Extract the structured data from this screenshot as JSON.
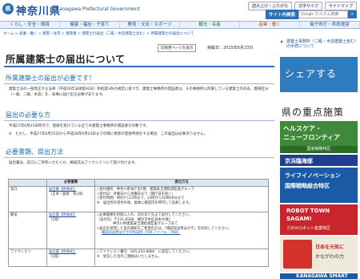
{
  "header": {
    "logo_mark": "県",
    "logo_text": "神奈川県",
    "logo_en": "Kanagawa Prefectural Government",
    "util_links": [
      "読み上げ・ふりがな",
      "文字サイズ",
      "サイトマップ"
    ],
    "search_label": "サイト内検索",
    "search_placeholder": "Google カスタム検索",
    "search_icon": "search-icon"
  },
  "gnav": [
    "くらし・安全・環境",
    "健康・福祉・子育て",
    "教育・文化・スポーツ",
    "観光・名産",
    "産業・働く",
    "電子県庁・県政運営"
  ],
  "breadcrumb": "ホーム > 産業・働く > 建築・住宅 > 建築業 > 建築士の届出（二級・木造建築士含む）> 所属建築士の届出について",
  "main": {
    "print_label": "印刷用ページを表示",
    "date_text": "掲載日：2015年6月23日",
    "title": "所属建築士の届出について",
    "sections": [
      {
        "heading": "所属建築士の届出が必要です！",
        "body": "建築士法の一部改正する法律（平成26年法律第92号）附則第3条の規定に基づき、建築士事務所の開設者は、その事務所に所属している建築士の氏名、資格区分（一級、二級、木造）を、知事に届け出る必要があります。"
      },
      {
        "heading": "届出の必要な方",
        "body": "平成27年6月25日時点で、登録を受けている全ての建築士事務所の開設者が対象です。",
        "note": "※　ただし、平成27年6月25日から平成28年6月24日までの間に更新の登録申請をする場合、この届出は必要ありません。"
      },
      {
        "heading": "必要書類、提出方法",
        "body": "届出書は、窓口にご持参いただくか、郵送又はファクシミリにて受け付けます。"
      }
    ],
    "table": {
      "headers": [
        "",
        "必要書類",
        "提出方法"
      ],
      "rows": [
        {
          "method": "窓口",
          "docs": [
            "届出書【原様式】",
            "（正本・副本　各1部）"
          ],
          "submit": [
            "◇受付場所：神奈川県本庁舎5階　建築安全課指導監査グループ",
            "◇受付日：月曜日から金曜日まで（閉庁日を除く）",
            "◇受付時間：9時から12時まで、13時から16時30分まで",
            "※　届出控の受付の後、副本に確認印を押印して返却します。"
          ]
        },
        {
          "method": "郵送",
          "docs": [
            "届出書【原様式】",
            "（1部）"
          ],
          "submit": [
            "◇必要書類を封筒に入れ、次のあて先まで送付してください。",
            "（送付先）〒231-8588　横浜市中区日本大通1",
            "神奈川県建築安全課指導監査グループあて",
            "◇届出を受理した旨の通知をご希望の方は、「確認返送用はがき」を同封してください。",
            "確認返送用はがきの作成例［PDFファイル／7KB］"
          ]
        },
        {
          "method": "ファクシミリ",
          "docs": [
            "届出書【原様式】",
            "（1部）"
          ],
          "submit": [
            "◇ファクシミリ番号：045-210-8884　に送信してください。",
            "※　受信した旨のご連絡はいたしません。"
          ]
        }
      ]
    }
  },
  "sidebar": {
    "links": [
      "建築士事務所（二級・木造建築士含む）の手続について"
    ],
    "share_title": "シェアする",
    "jyuten_title": "県の重点施策",
    "banners": [
      {
        "main": "ヘルスケア・",
        "sub": "ニューフロンティア",
        "tag": "国家戦略特区"
      },
      {
        "main": "京浜臨海部"
      },
      {
        "main": "ライフイノベーション",
        "sub": "国際戦略総合特区"
      },
      {
        "main": "ROBOT TOWN",
        "sub": "SAGAMI",
        "tag": "さがみロボット産業特区"
      },
      {
        "main": "日本を元気に",
        "sub": "かながわの力"
      },
      {
        "main": "KANAGAWA SMART"
      }
    ]
  }
}
